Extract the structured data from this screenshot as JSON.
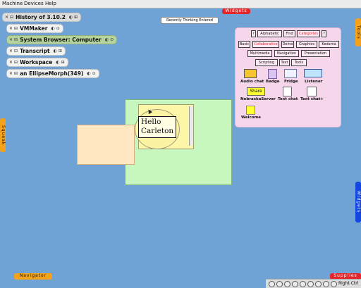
{
  "host_menu": [
    "Machine",
    "Devices",
    "Help"
  ],
  "top_flap": "Widgets",
  "right_flap_tools": "Tools",
  "left_flap_squeak": "Squeak",
  "right_flap_blue": "Widgets",
  "bottom_left_flap": "Navigator",
  "bottom_right_flap": "Supplies",
  "pending_changes_title": "Recently Thinking Entered",
  "windows": [
    {
      "title": "History of 3.10.2",
      "style": "gray"
    },
    {
      "title": "VMMaker",
      "style": "plain"
    },
    {
      "title": "System Browser: Computer",
      "style": "green"
    },
    {
      "title": "Transcript",
      "style": "plain"
    },
    {
      "title": "Workspace",
      "style": "plain"
    },
    {
      "title": "an EllipseMorph(349)",
      "style": "plain"
    }
  ],
  "supplies_window": {
    "top_buttons": [
      "?",
      "Alphabetic",
      "Find",
      "Categories",
      "?"
    ],
    "selected_top": "Categories",
    "category_rows": [
      [
        "Basic",
        "Collaborative",
        "Demo",
        "Graphics",
        "Kedama"
      ],
      [
        "Multimedia",
        "Navigation",
        "Presentation"
      ],
      [
        "Scripting",
        "Text",
        "Tools"
      ]
    ],
    "selected_category": "Collaborative",
    "tools": [
      {
        "label": "Audio chat",
        "icon": "audio-chat-icon"
      },
      {
        "label": "Badge",
        "icon": "badge-icon"
      },
      {
        "label": "Fridge",
        "icon": "fridge-icon"
      },
      {
        "label": "Listener",
        "icon": "listener-icon"
      },
      {
        "label": "NebraskaServer",
        "icon": "nebraska-server-icon",
        "badge_text": "Share"
      },
      {
        "label": "Text chat",
        "icon": "text-chat-icon"
      },
      {
        "label": "Text chat+",
        "icon": "text-chat-plus-icon"
      },
      {
        "label": "Welcome",
        "icon": "welcome-icon"
      }
    ]
  },
  "text_morph": {
    "line1": "Hello",
    "line2": "Carleton"
  },
  "taskbar": {
    "right_ctrl": "Right Ctrl"
  }
}
